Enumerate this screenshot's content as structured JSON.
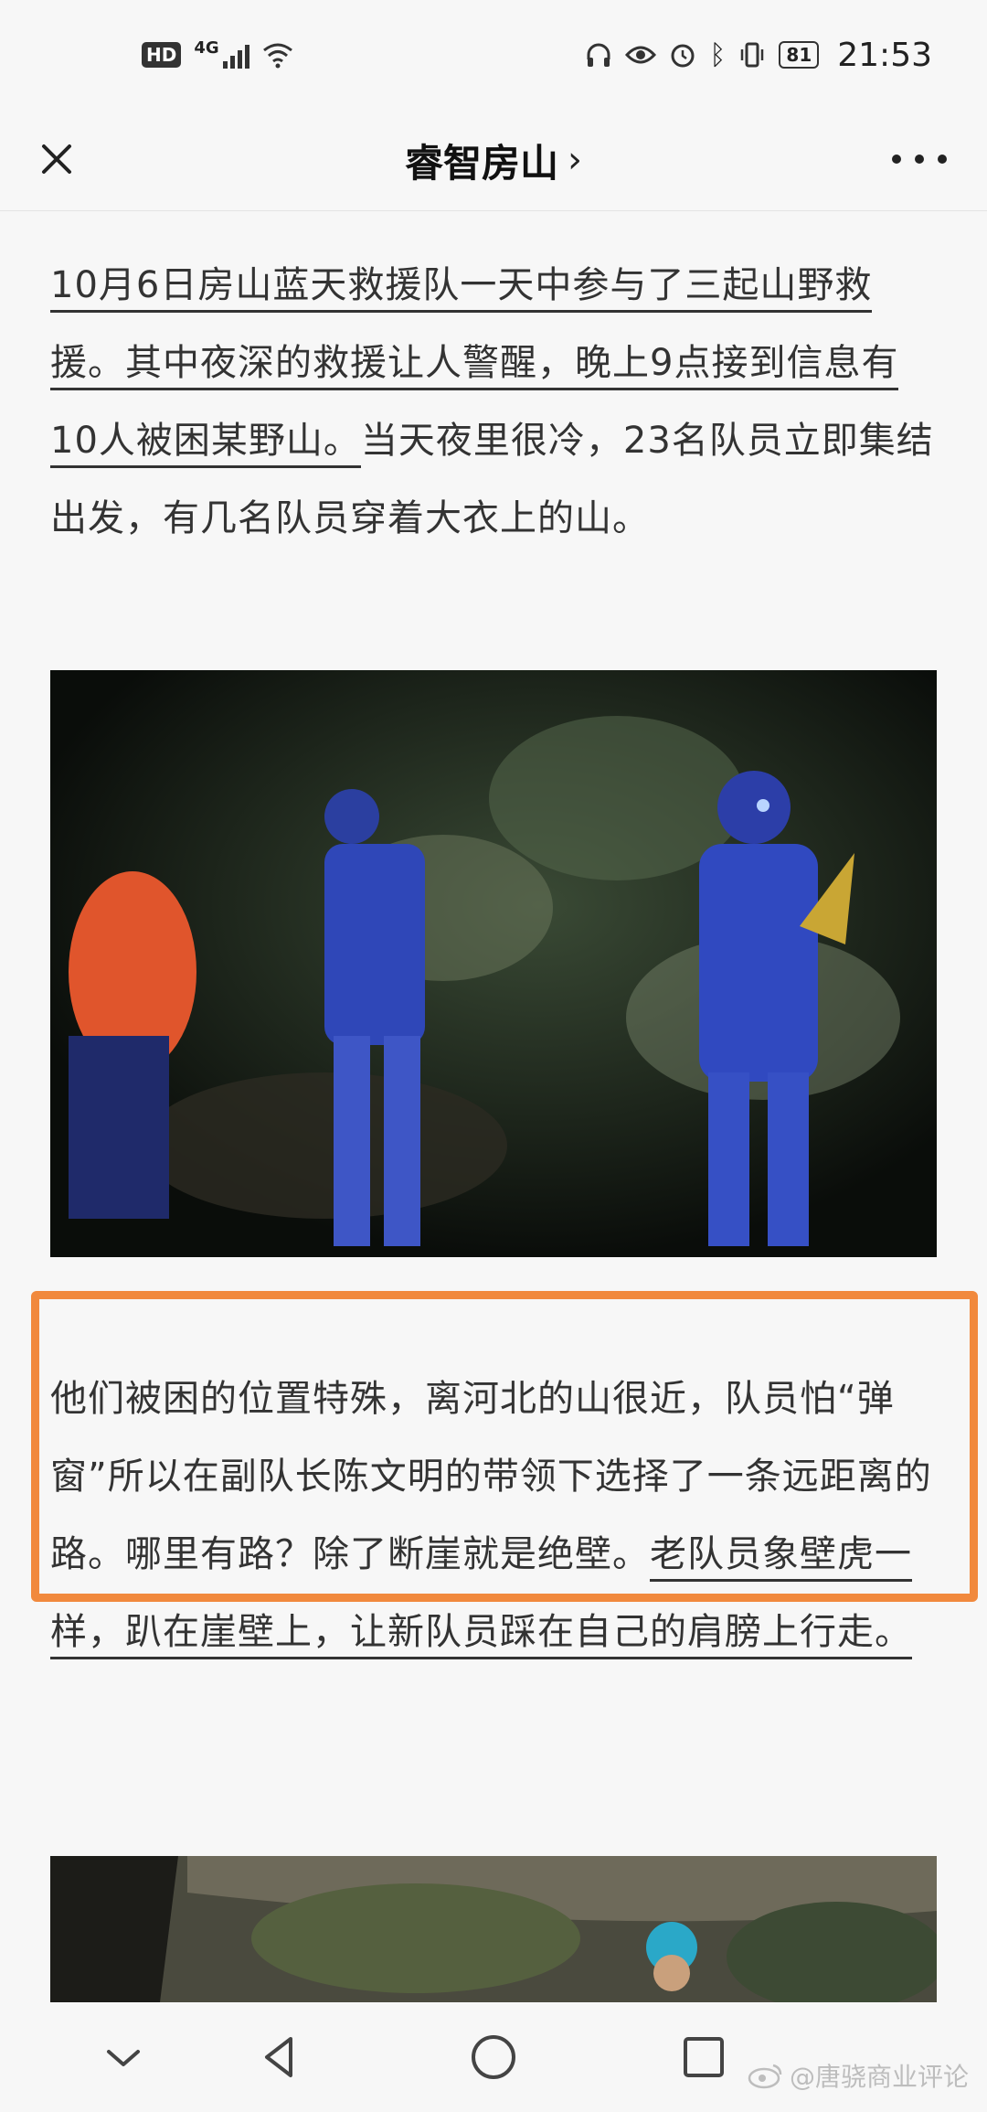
{
  "status_bar": {
    "hd": "HD",
    "network": "4G",
    "battery": "81",
    "time": "21:53"
  },
  "header": {
    "title": "睿智房山",
    "chevron": "›"
  },
  "article": {
    "para1": {
      "underlined": "10月6日房山蓝天救援队一天中参与了三起山野救援。其中夜深的救援让人警醒，晚上9点接到信息有10人被困某野山。",
      "plain": "当天夜里很冷，23名队员立即集结出发，有几名队员穿着大衣上的山。"
    },
    "para2": {
      "plain": "他们被困的位置特殊，离河北的山很近，队员怕“弹窗”所以在副队长陈文明的带领下选择了一条远距离的路。哪里有路？除了断崖就是绝壁。",
      "underlined": "老队员象壁虎一样，趴在崖壁上，让新队员踩在自己的肩膀上行走。"
    }
  },
  "watermark": "@唐骁商业评论",
  "colors": {
    "highlight_border": "#f1893d",
    "background": "#f7f7f7"
  },
  "icons": {
    "close": "close-icon",
    "more": "more-icon",
    "nav_hide": "chevron-down-icon",
    "nav_back": "back-triangle-icon",
    "nav_home": "home-circle-icon",
    "nav_recents": "recents-square-icon"
  }
}
